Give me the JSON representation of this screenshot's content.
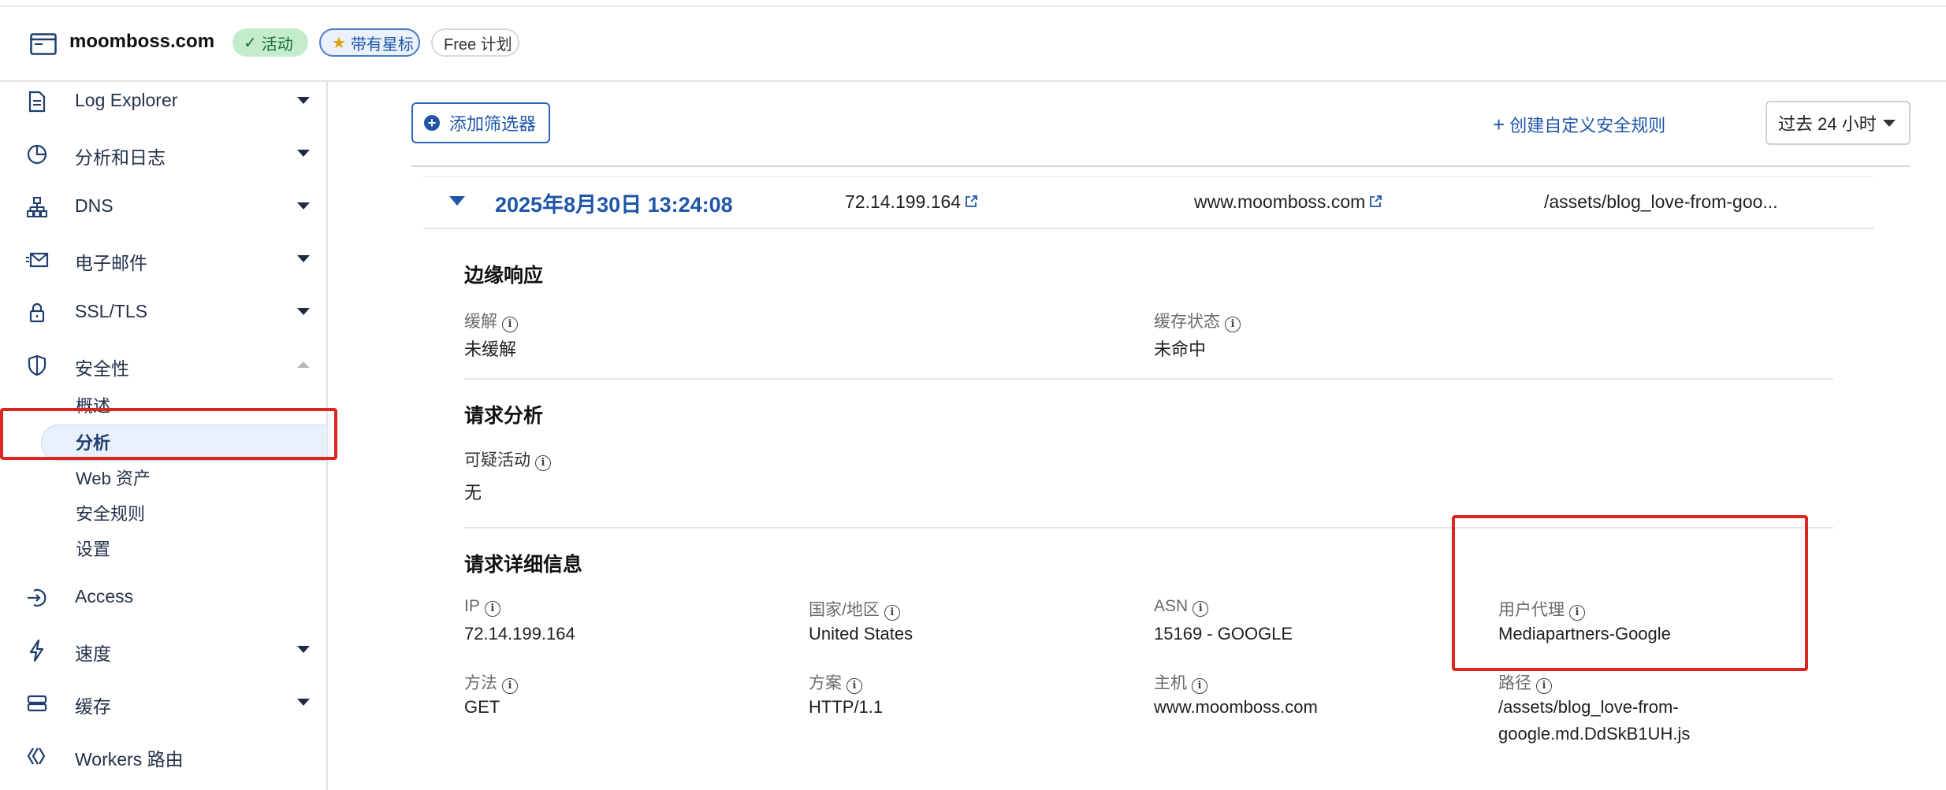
{
  "header": {
    "site_name": "moomboss.com",
    "badge_active": "活动",
    "badge_starred": "带有星标",
    "badge_plan": "Free 计划"
  },
  "sidebar": {
    "items": [
      {
        "label": "Log Explorer",
        "icon": "log-explorer-icon",
        "expandable": true
      },
      {
        "label": "分析和日志",
        "icon": "pie-chart-icon",
        "expandable": true
      },
      {
        "label": "DNS",
        "icon": "dns-network-icon",
        "expandable": true
      },
      {
        "label": "电子邮件",
        "icon": "email-icon",
        "expandable": true
      },
      {
        "label": "SSL/TLS",
        "icon": "lock-icon",
        "expandable": true
      },
      {
        "label": "安全性",
        "icon": "shield-icon",
        "expanded": true
      },
      {
        "label": "Access",
        "icon": "access-icon",
        "expandable": false
      },
      {
        "label": "速度",
        "icon": "lightning-icon",
        "expandable": true
      },
      {
        "label": "缓存",
        "icon": "cache-icon",
        "expandable": true
      },
      {
        "label": "Workers 路由",
        "icon": "workers-icon",
        "expandable": false
      }
    ],
    "security_sub": [
      "概述",
      "分析",
      "Web 资产",
      "安全规则",
      "设置"
    ],
    "active_sub": "分析"
  },
  "toolbar": {
    "add_filter": "添加筛选器",
    "create_rule": "创建自定义安全规则",
    "time_range": "过去 24 小时"
  },
  "event_row": {
    "datetime": "2025年8月30日 13:24:08",
    "ip": "72.14.199.164",
    "host": "www.moomboss.com",
    "path": "/assets/blog_love-from-goo..."
  },
  "edge_response": {
    "title": "边缘响应",
    "mitigation_label": "缓解",
    "mitigation_value": "未缓解",
    "cache_status_label": "缓存状态",
    "cache_status_value": "未命中"
  },
  "request_analysis": {
    "title": "请求分析",
    "suspicious_label": "可疑活动",
    "suspicious_value": "无"
  },
  "request_details": {
    "title": "请求详细信息",
    "ip_label": "IP",
    "ip_value": "72.14.199.164",
    "country_label": "国家/地区",
    "country_value": "United States",
    "asn_label": "ASN",
    "asn_value": "15169 - GOOGLE",
    "ua_label": "用户代理",
    "ua_value": "Mediapartners-Google",
    "method_label": "方法",
    "method_value": "GET",
    "scheme_label": "方案",
    "scheme_value": "HTTP/1.1",
    "host_label": "主机",
    "host_value": "www.moomboss.com",
    "path_label": "路径",
    "path_value_line1": "/assets/blog_love-from-",
    "path_value_line2": "google.md.DdSkB1UH.js"
  },
  "colors": {
    "accent": "#1f56a8",
    "highlight_box": "#d9271f",
    "active_badge_bg": "#c3eccd"
  }
}
